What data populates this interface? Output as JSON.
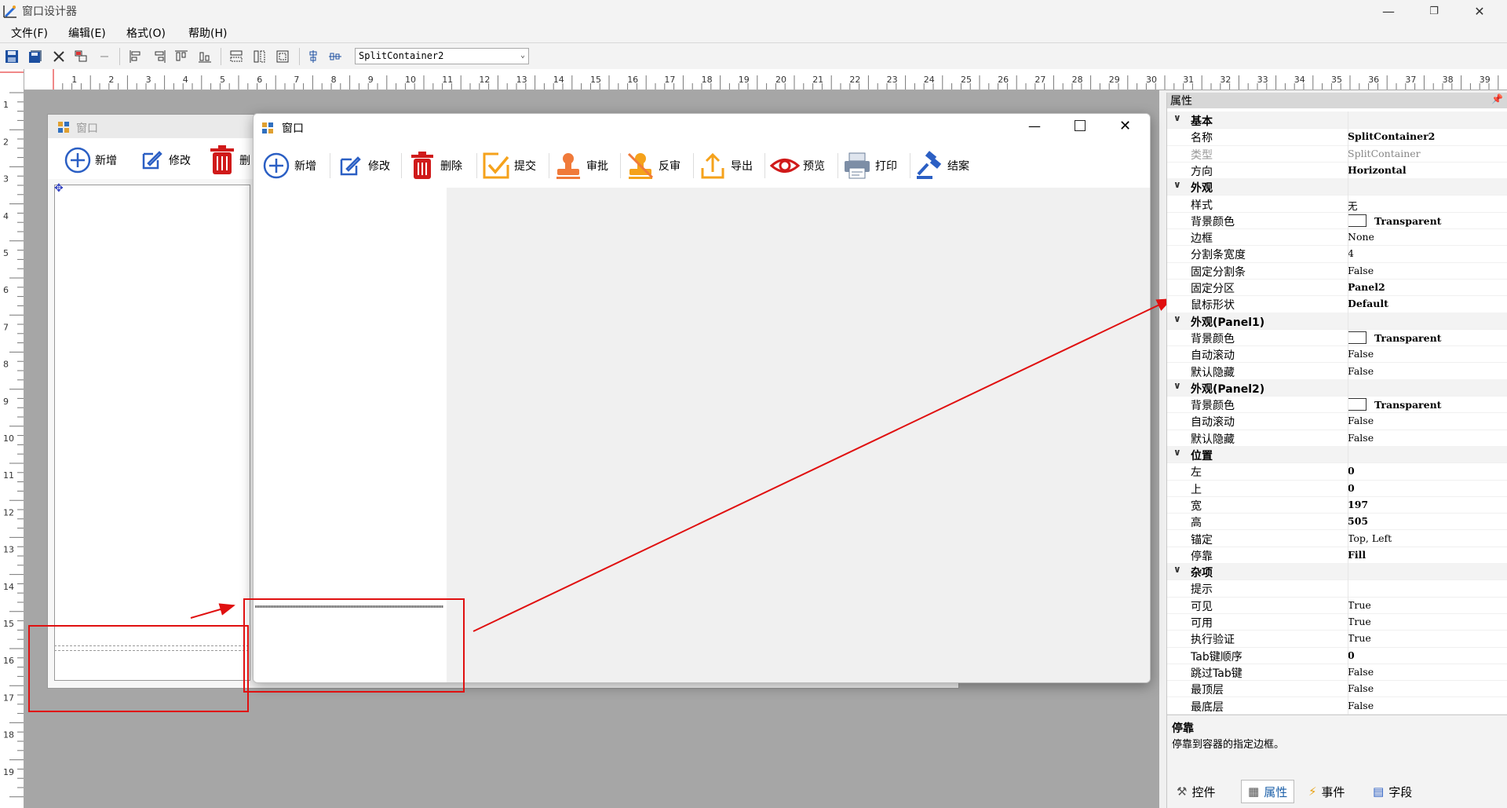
{
  "window": {
    "title": "窗口设计器"
  },
  "menu": [
    "文件(F)",
    "编辑(E)",
    "格式(O)",
    "帮助(H)"
  ],
  "toolbar": {
    "combo_value": "SplitContainer2"
  },
  "background_form": {
    "title": "窗口",
    "buttons": [
      "新增",
      "修改",
      "删"
    ]
  },
  "main_form": {
    "title": "窗口",
    "buttons": [
      {
        "label": "新增",
        "icon": "plus-circle-icon"
      },
      {
        "label": "修改",
        "icon": "edit-icon"
      },
      {
        "label": "删除",
        "icon": "trash-icon"
      },
      {
        "label": "提交",
        "icon": "submit-check-icon"
      },
      {
        "label": "审批",
        "icon": "stamp-icon"
      },
      {
        "label": "反审",
        "icon": "unstamp-icon"
      },
      {
        "label": "导出",
        "icon": "export-icon"
      },
      {
        "label": "预览",
        "icon": "eye-icon"
      },
      {
        "label": "打印",
        "icon": "printer-icon"
      },
      {
        "label": "结案",
        "icon": "gavel-icon"
      }
    ]
  },
  "properties": {
    "header": "属性",
    "rows": [
      {
        "type": "cat",
        "label": "基本"
      },
      {
        "label": "名称",
        "value": "SplitContainer2",
        "bold": true
      },
      {
        "label": "类型",
        "value": "SplitContainer",
        "gray": true
      },
      {
        "label": "方向",
        "value": "Horizontal",
        "bold": true
      },
      {
        "type": "cat",
        "label": "外观"
      },
      {
        "label": "样式",
        "value": "无"
      },
      {
        "label": "背景颜色",
        "value": "Transparent",
        "bold": true,
        "swatch": true
      },
      {
        "label": "边框",
        "value": "None"
      },
      {
        "label": "分割条宽度",
        "value": "4"
      },
      {
        "label": "固定分割条",
        "value": "False"
      },
      {
        "label": "固定分区",
        "value": "Panel2",
        "bold": true
      },
      {
        "label": "鼠标形状",
        "value": "Default",
        "bold": true
      },
      {
        "type": "cat",
        "label": "外观(Panel1)"
      },
      {
        "label": "背景颜色",
        "value": "Transparent",
        "bold": true,
        "swatch": true
      },
      {
        "label": "自动滚动",
        "value": "False"
      },
      {
        "label": "默认隐藏",
        "value": "False"
      },
      {
        "type": "cat",
        "label": "外观(Panel2)"
      },
      {
        "label": "背景颜色",
        "value": "Transparent",
        "bold": true,
        "swatch": true
      },
      {
        "label": "自动滚动",
        "value": "False"
      },
      {
        "label": "默认隐藏",
        "value": "False"
      },
      {
        "type": "cat",
        "label": "位置"
      },
      {
        "label": "左",
        "value": "0",
        "bold": true
      },
      {
        "label": "上",
        "value": "0",
        "bold": true
      },
      {
        "label": "宽",
        "value": "197",
        "bold": true
      },
      {
        "label": "高",
        "value": "505",
        "bold": true
      },
      {
        "label": "锚定",
        "value": "Top, Left"
      },
      {
        "label": "停靠",
        "value": "Fill",
        "bold": true
      },
      {
        "type": "cat",
        "label": "杂项"
      },
      {
        "label": "提示",
        "value": ""
      },
      {
        "label": "可见",
        "value": "True"
      },
      {
        "label": "可用",
        "value": "True"
      },
      {
        "label": "执行验证",
        "value": "True"
      },
      {
        "label": "Tab键顺序",
        "value": "0",
        "bold": true
      },
      {
        "label": "跳过Tab键",
        "value": "False"
      },
      {
        "label": "最顶层",
        "value": "False"
      },
      {
        "label": "最底层",
        "value": "False"
      }
    ],
    "desc_title": "停靠",
    "desc_text": "停靠到容器的指定边框。"
  },
  "bottom_tabs": [
    "控件",
    "属性",
    "事件",
    "字段"
  ],
  "ruler_h": [
    "1",
    "2",
    "3",
    "4",
    "5",
    "6",
    "7",
    "8",
    "9",
    "10",
    "11",
    "12",
    "13",
    "14",
    "15",
    "16",
    "17",
    "18",
    "19",
    "20",
    "21",
    "22",
    "23",
    "24",
    "25",
    "26",
    "27",
    "28",
    "29",
    "30",
    "31",
    "32",
    "33",
    "34",
    "35",
    "36",
    "37",
    "38",
    "39"
  ],
  "ruler_v": [
    "1",
    "2",
    "3",
    "4",
    "5",
    "6",
    "7",
    "8",
    "9",
    "10",
    "11",
    "12",
    "13",
    "14",
    "15",
    "16",
    "17",
    "18",
    "19"
  ],
  "colors": {
    "accent_red": "#e01010",
    "canvas_gray": "#a6a6a6"
  }
}
